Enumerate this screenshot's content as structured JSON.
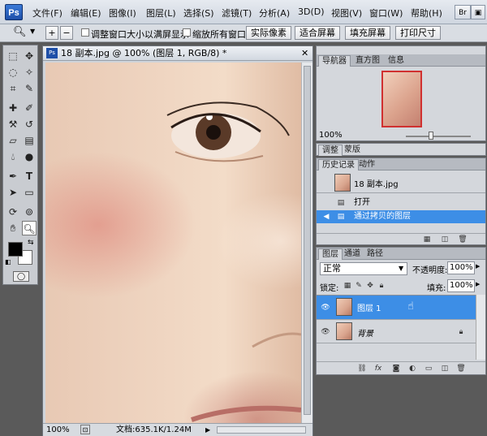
{
  "app": {
    "logo": "Ps"
  },
  "menubar": {
    "items": [
      "文件(F)",
      "编辑(E)",
      "图像(I)",
      "图层(L)",
      "选择(S)",
      "滤镜(T)",
      "分析(A)",
      "3D(D)",
      "视图(V)",
      "窗口(W)",
      "帮助(H)"
    ],
    "right_buttons": [
      "Br",
      "▣"
    ]
  },
  "options_bar": {
    "tool_icon": "zoom-icon",
    "chk_resize_windows": "调整窗口大小以满屏显示",
    "chk_zoom_all": "缩放所有窗口",
    "btn_actual_pixels": "实际像素",
    "btn_fit_screen": "适合屏幕",
    "btn_fill_screen": "填充屏幕",
    "btn_print_size": "打印尺寸"
  },
  "document": {
    "title": "18 副本.jpg @ 100% (图层 1, RGB/8) *",
    "zoom": "100%",
    "doc_info": "文档:635.1K/1.24M"
  },
  "navigator": {
    "tabs": [
      "导航器",
      "直方图",
      "信息"
    ],
    "zoom": "100%"
  },
  "adjust_panel": {
    "tabs": [
      "调整",
      "蒙版"
    ]
  },
  "history": {
    "tabs": [
      "历史记录",
      "动作"
    ],
    "snapshot": "18 副本.jpg",
    "items": [
      "打开",
      "通过拷贝的图层"
    ]
  },
  "layers": {
    "tabs": [
      "图层",
      "通道",
      "路径"
    ],
    "blend_mode": "正常",
    "opacity_label": "不透明度:",
    "opacity": "100%",
    "lock_label": "锁定:",
    "fill_label": "填充:",
    "fill": "100%",
    "items": [
      {
        "name": "图层 1",
        "selected": true
      },
      {
        "name": "背景",
        "selected": false
      }
    ]
  },
  "colors": {
    "selection": "#3d8ee6",
    "foreground": "#000000",
    "background": "#ffffff"
  }
}
